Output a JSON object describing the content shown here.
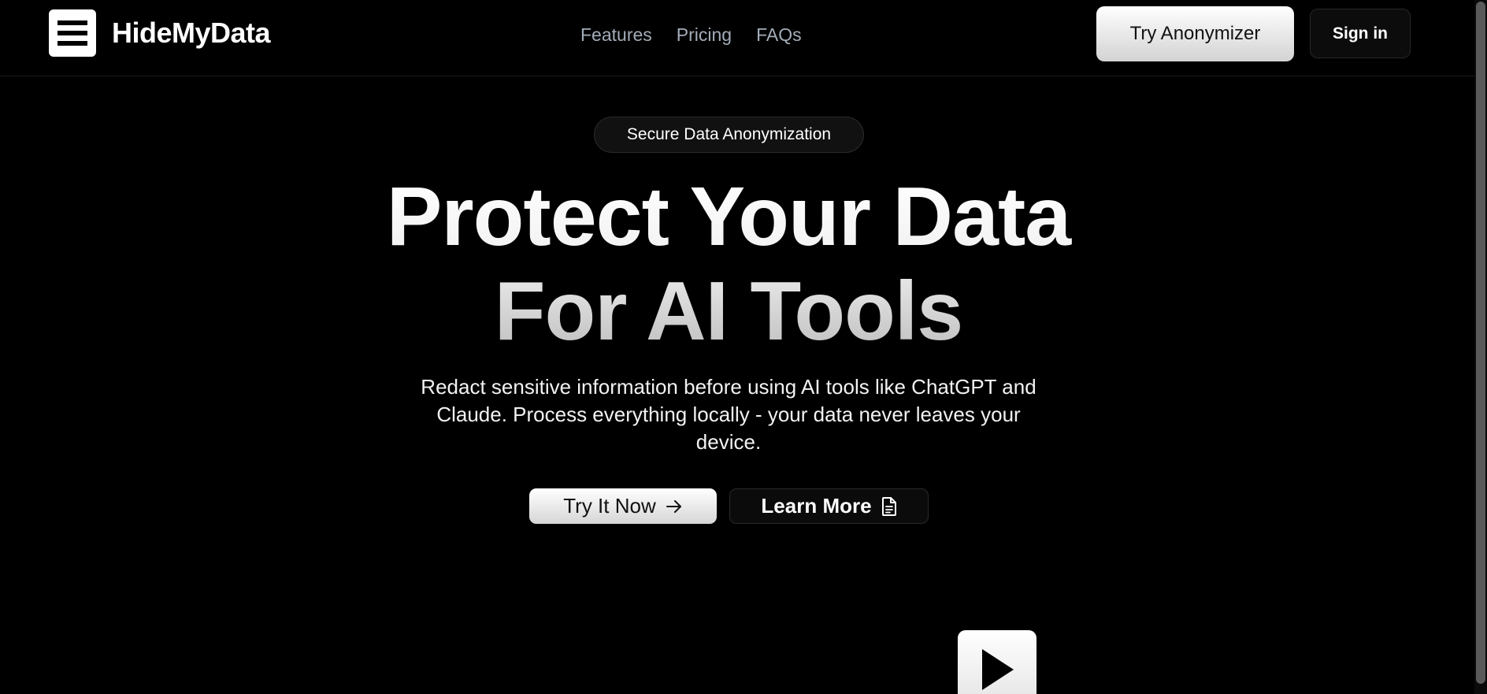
{
  "brand": {
    "name": "HideMyData",
    "logo_icon": "menu-icon"
  },
  "nav": {
    "items": [
      {
        "label": "Features"
      },
      {
        "label": "Pricing"
      },
      {
        "label": "FAQs"
      }
    ]
  },
  "header": {
    "try_anonymizer_label": "Try Anonymizer",
    "sign_in_label": "Sign in"
  },
  "hero": {
    "badge": "Secure Data Anonymization",
    "title_line1": "Protect Your Data",
    "title_line2": "For AI Tools",
    "subtitle": "Redact sensitive information before using AI tools like ChatGPT and Claude. Process everything locally - your data never leaves your device.",
    "cta_primary": "Try It Now",
    "cta_primary_icon": "arrow-right-icon",
    "cta_secondary": "Learn More",
    "cta_secondary_icon": "document-icon",
    "video_icon": "play-icon"
  },
  "colors": {
    "background": "#000000",
    "nav_text": "#a3acb8",
    "primary_button": "#ffffff"
  }
}
